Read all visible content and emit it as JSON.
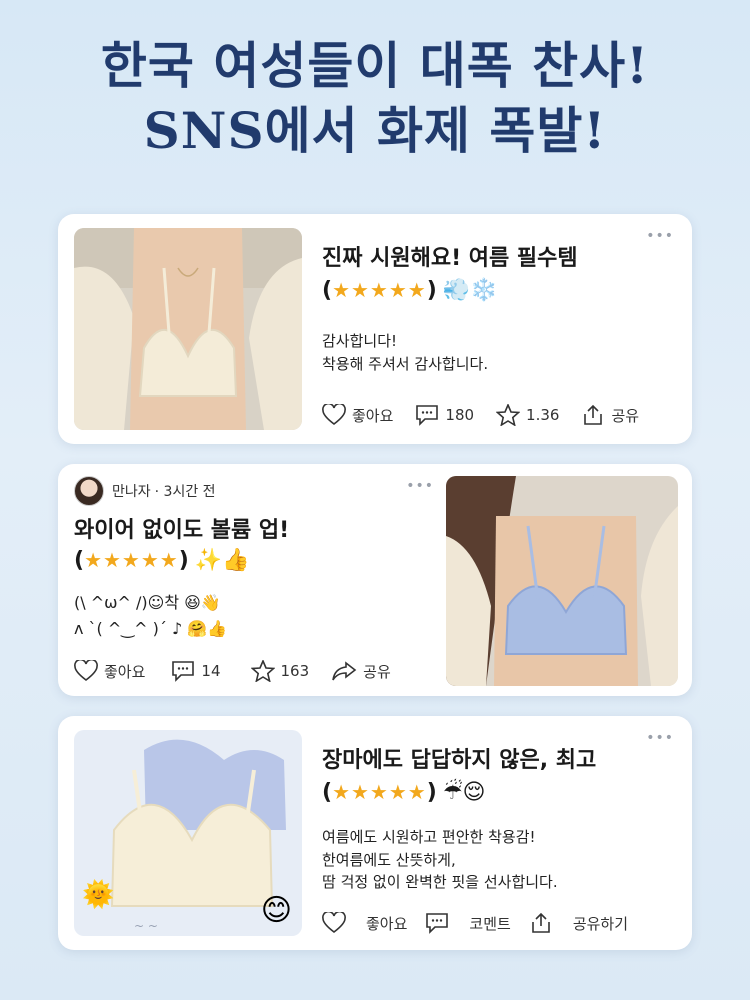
{
  "headline": {
    "line1": "한국 여성들이 대폭 찬사!",
    "line2": "SNS에서 화제 폭발!"
  },
  "cards": [
    {
      "title": "진짜 시원해요! 여름 필수템",
      "rating": {
        "open": "(",
        "stars": "★★★★★",
        "close": ")",
        "emoji": "💨❄️"
      },
      "body": [
        "감사합니다!",
        "착용해 주셔서 감사합니다."
      ],
      "actions": {
        "like": "좋아요",
        "comments": "180",
        "stars": "1.36",
        "share": "공유"
      },
      "dots": "•••"
    },
    {
      "author": {
        "name": "만나자",
        "time": "· 3시간 전"
      },
      "title": "와이어 없이도 볼륨 업!",
      "rating": {
        "open": "(",
        "stars": "★★★★★",
        "close": ")",
        "emoji": "✨👍"
      },
      "body": [
        "(\\ ^ω^ /)☺착 😆👋",
        "ʌ `( ^‿^ )´ ♪ 🤗👍"
      ],
      "actions": {
        "like": "좋아요",
        "comments": "14",
        "stars": "163",
        "share": "공유"
      },
      "dots": "•••"
    },
    {
      "title": "장마에도 답답하지 않은, 최고",
      "rating": {
        "open": "(",
        "stars": "★★★★★",
        "close": ")",
        "emoji": "☔😌"
      },
      "body": [
        "여름에도 시원하고 편안한 착용감!",
        "한여름에도 산뜻하게,",
        "땀 걱정 없이 완벽한 핏을 선사합니다."
      ],
      "actions": {
        "like": "좋아요",
        "comments": "코멘트",
        "share": "공유하기"
      },
      "dots": "•••"
    }
  ],
  "colors": {
    "headline": "#213b6d",
    "star": "#f2a81d",
    "background": "#dbe9f5"
  }
}
